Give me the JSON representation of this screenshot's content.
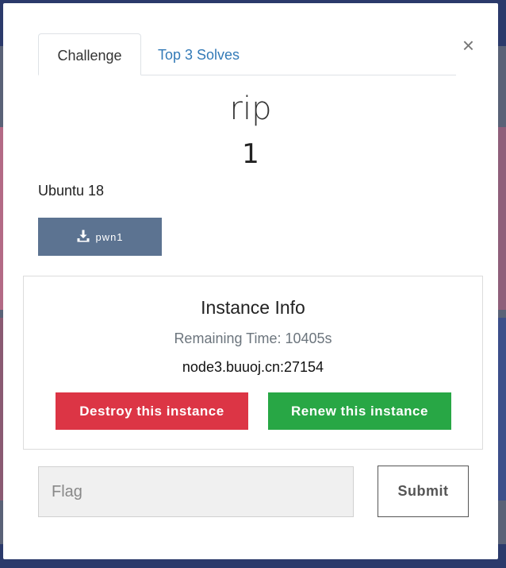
{
  "modal": {
    "close_label": "×",
    "tabs": [
      {
        "label": "Challenge"
      },
      {
        "label": "Top 3 Solves"
      }
    ]
  },
  "challenge": {
    "name": "rip",
    "value": "1",
    "description": "Ubuntu 18",
    "file": {
      "label": "pwn1",
      "icon": "download-icon"
    }
  },
  "instance": {
    "title": "Instance Info",
    "remaining_time": "Remaining Time: 10405s",
    "host": "node3.buuoj.cn:27154",
    "destroy_label": "Destroy this instance",
    "renew_label": "Renew this instance"
  },
  "submission": {
    "flag_placeholder": "Flag",
    "submit_label": "Submit"
  },
  "colors": {
    "destroy": "#dc3545",
    "renew": "#28a745",
    "file_button": "#5c7391",
    "tab_link": "#337ab7"
  }
}
